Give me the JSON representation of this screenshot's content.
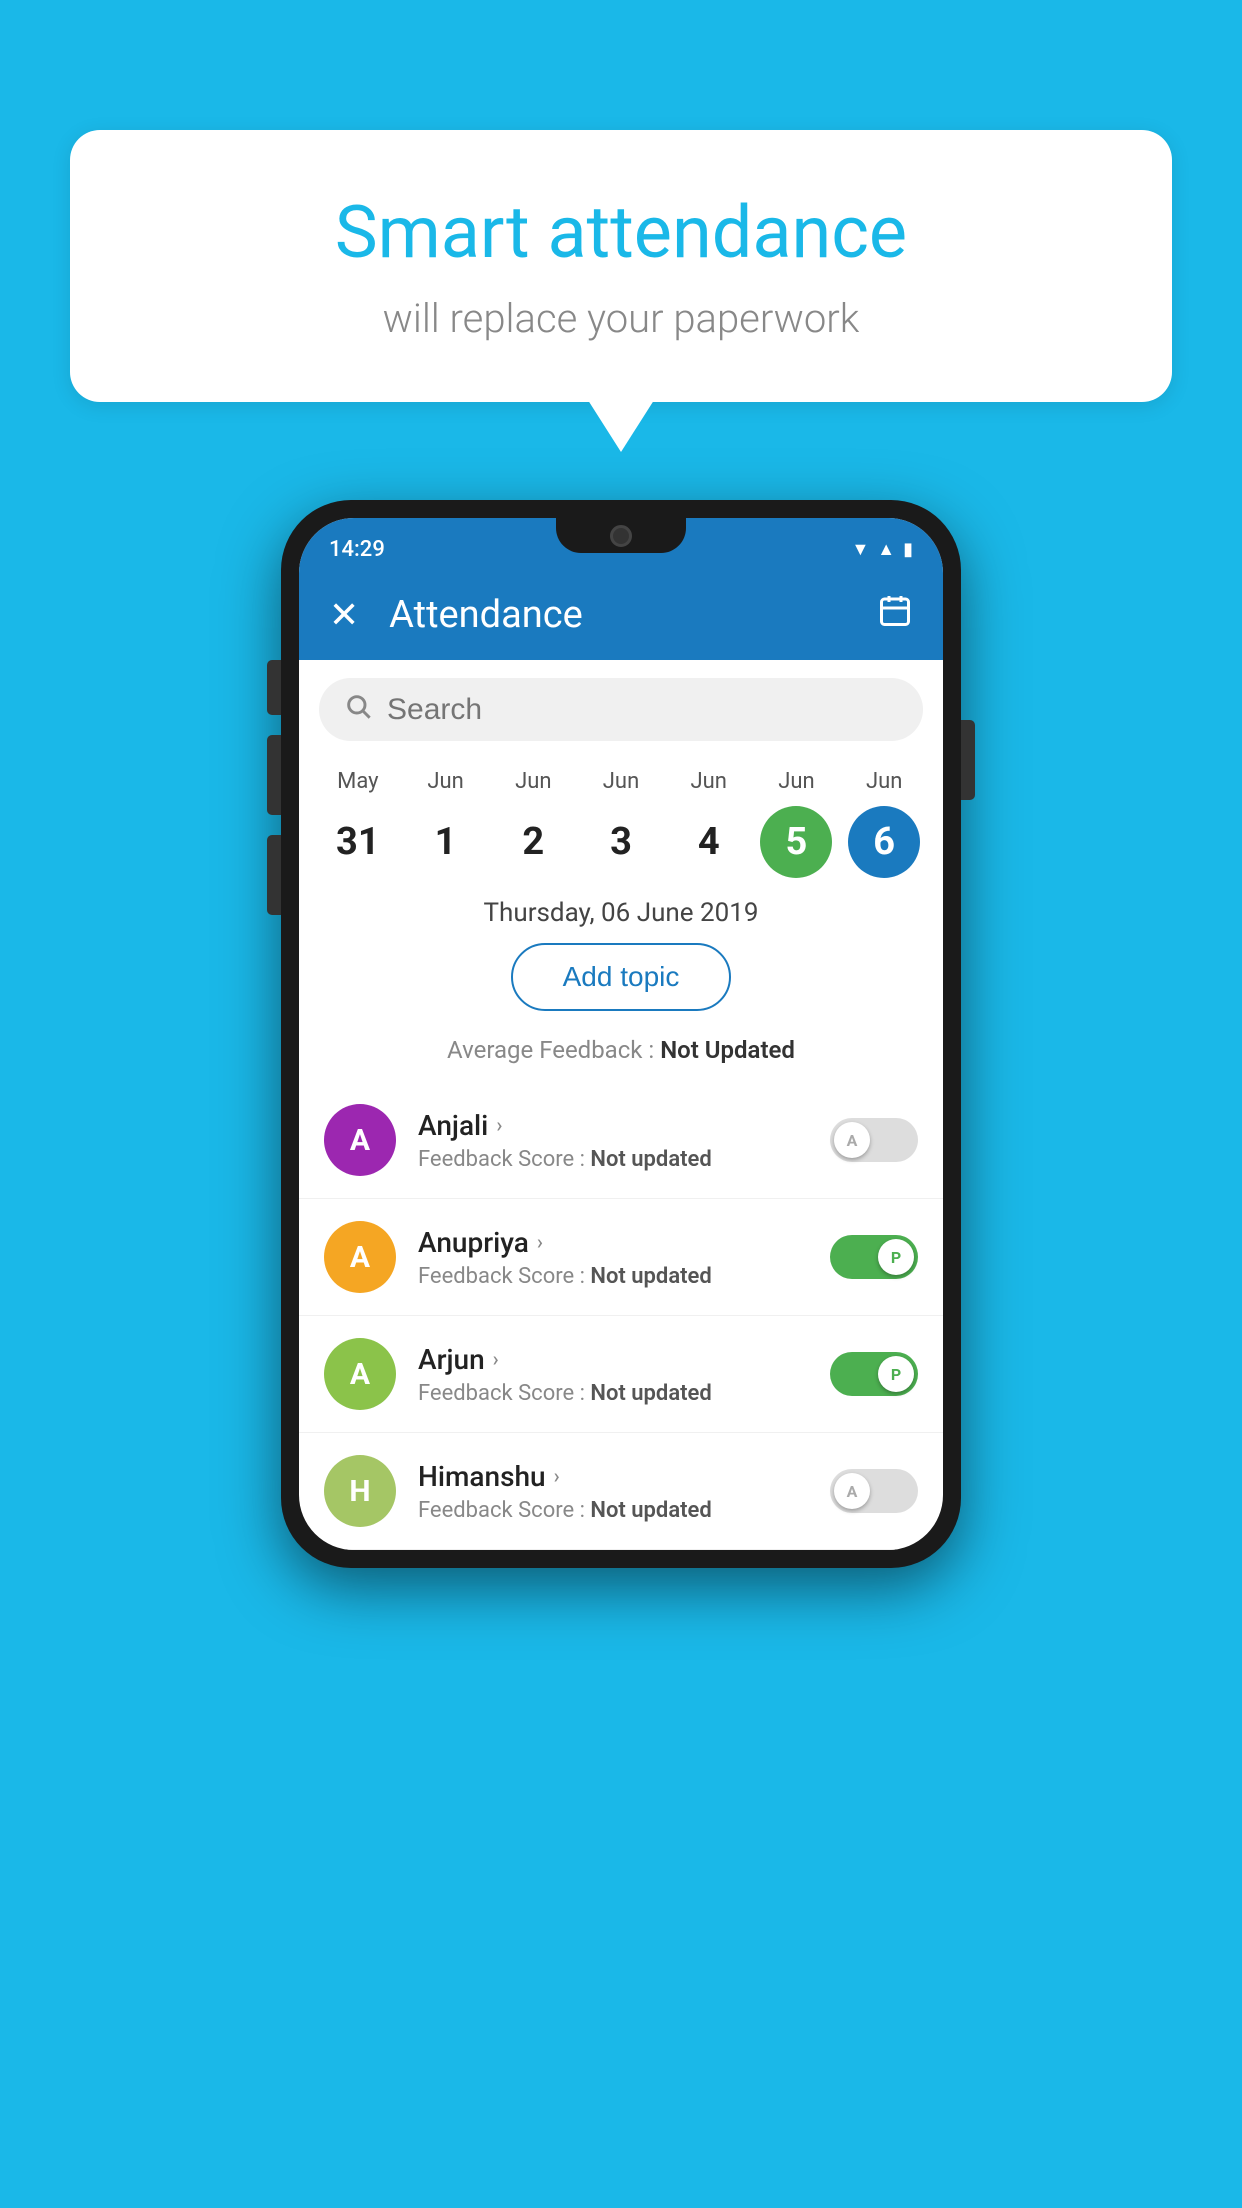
{
  "background_color": "#1ab8e8",
  "bubble": {
    "title": "Smart attendance",
    "subtitle": "will replace your paperwork"
  },
  "phone": {
    "status_bar": {
      "time": "14:29",
      "icons": [
        "wifi",
        "signal",
        "battery"
      ]
    },
    "app_bar": {
      "title": "Attendance",
      "close_label": "×",
      "calendar_label": "📅"
    },
    "search": {
      "placeholder": "Search"
    },
    "calendar": {
      "days": [
        {
          "month": "May",
          "number": "31",
          "state": "normal"
        },
        {
          "month": "Jun",
          "number": "1",
          "state": "normal"
        },
        {
          "month": "Jun",
          "number": "2",
          "state": "normal"
        },
        {
          "month": "Jun",
          "number": "3",
          "state": "normal"
        },
        {
          "month": "Jun",
          "number": "4",
          "state": "normal"
        },
        {
          "month": "Jun",
          "number": "5",
          "state": "today"
        },
        {
          "month": "Jun",
          "number": "6",
          "state": "selected"
        }
      ]
    },
    "selected_date": "Thursday, 06 June 2019",
    "add_topic_label": "Add topic",
    "avg_feedback_label": "Average Feedback : ",
    "avg_feedback_value": "Not Updated",
    "students": [
      {
        "name": "Anjali",
        "avatar_letter": "A",
        "avatar_color": "#9c27b0",
        "feedback_label": "Feedback Score : ",
        "feedback_value": "Not updated",
        "toggle": "off",
        "toggle_label": "A"
      },
      {
        "name": "Anupriya",
        "avatar_letter": "A",
        "avatar_color": "#f5a623",
        "feedback_label": "Feedback Score : ",
        "feedback_value": "Not updated",
        "toggle": "on",
        "toggle_label": "P"
      },
      {
        "name": "Arjun",
        "avatar_letter": "A",
        "avatar_color": "#8bc34a",
        "feedback_label": "Feedback Score : ",
        "feedback_value": "Not updated",
        "toggle": "on",
        "toggle_label": "P"
      },
      {
        "name": "Himanshu",
        "avatar_letter": "H",
        "avatar_color": "#a5c665",
        "feedback_label": "Feedback Score : ",
        "feedback_value": "Not updated",
        "toggle": "off",
        "toggle_label": "A"
      }
    ]
  }
}
